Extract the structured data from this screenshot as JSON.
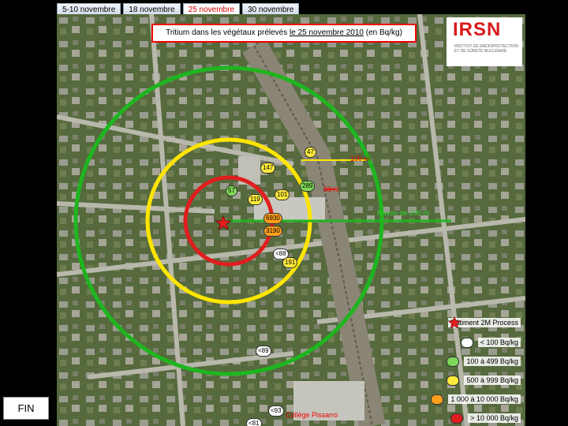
{
  "tabs": [
    {
      "label": "5-10 novembre"
    },
    {
      "label": "18 novembre"
    },
    {
      "label": "25 novembre"
    },
    {
      "label": "30 novembre"
    }
  ],
  "title": {
    "prefix": "Tritium dans les végétaux prélevés ",
    "date": "le 25 novembre 2010",
    "suffix": " (en Bq/kg)"
  },
  "logo": {
    "word": "IRSN",
    "subtitle": "Institut de radioprotection et de sûreté nucléaire"
  },
  "measurements": [
    {
      "value": "47",
      "color": "yellow"
    },
    {
      "value": "147",
      "color": "yellow"
    },
    {
      "value": "57",
      "color": "green"
    },
    {
      "value": "119",
      "color": "yellow"
    },
    {
      "value": "101",
      "color": "yellow"
    },
    {
      "value": "289",
      "color": "green"
    },
    {
      "value": "6930",
      "color": "orange"
    },
    {
      "value": "3190",
      "color": "orange"
    },
    {
      "value": "<88",
      "color": "white"
    },
    {
      "value": "191",
      "color": "yellow"
    },
    {
      "value": "<89",
      "color": "white"
    },
    {
      "value": "<93",
      "color": "white"
    },
    {
      "value": "<81",
      "color": "white"
    }
  ],
  "distances": {
    "r100": "100 m",
    "r50": "50 m",
    "r200": "Rayon de 200 m"
  },
  "places": {
    "college": "Collège Pissarro"
  },
  "legend": [
    {
      "symbol": "star",
      "label": "Bâtiment 2M Process",
      "color": "#e01e1e"
    },
    {
      "symbol": "swatch",
      "label": "< 100 Bq/kg",
      "color": "#ffffff"
    },
    {
      "symbol": "swatch",
      "label": "100 à 499 Bq/kg",
      "color": "#7ed957"
    },
    {
      "symbol": "swatch",
      "label": "500 à 999 Bq/kg",
      "color": "#ffeb3b"
    },
    {
      "symbol": "swatch",
      "label": "1 000 à 10 000 Bq/kg",
      "color": "#ff9f1c"
    },
    {
      "symbol": "swatch",
      "label": "> 10 000 Bq/kg",
      "color": "#e01e1e"
    }
  ],
  "nav": {
    "fin_label": "FIN"
  },
  "colors": {
    "circle_200m": "#1fb51f",
    "circle_100m": "#ffe500",
    "circle_50m": "#e01e1e",
    "title_border": "#e00000"
  }
}
